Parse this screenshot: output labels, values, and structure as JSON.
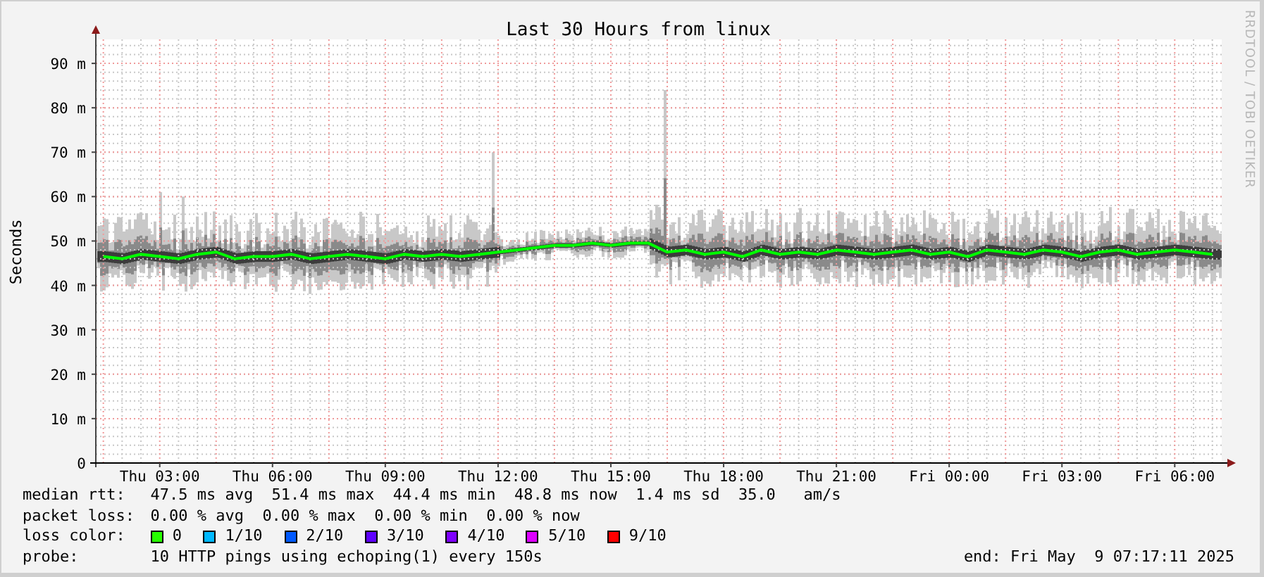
{
  "title": "Last 30 Hours from linux",
  "credit": "RRDTOOL / TOBI OETIKER",
  "chart_data": {
    "type": "line",
    "grid": true,
    "ylabel": "Seconds",
    "ylim": [
      0,
      95.4
    ],
    "categories": [
      null,
      null,
      null,
      "Thu 03:00",
      null,
      null,
      null,
      null,
      null,
      "Thu 06:00",
      null,
      null,
      null,
      null,
      null,
      "Thu 09:00",
      null,
      null,
      null,
      null,
      null,
      "Thu 12:00",
      null,
      null,
      null,
      null,
      null,
      "Thu 15:00",
      null,
      null,
      null,
      null,
      null,
      "Thu 18:00",
      null,
      null,
      null,
      null,
      null,
      "Thu 21:00",
      null,
      null,
      null,
      null,
      null,
      "Fri 00:00",
      null,
      null,
      null,
      null,
      null,
      "Fri 03:00",
      null,
      null,
      null,
      null,
      null,
      "Fri 06:00",
      null,
      null
    ],
    "yticks": [
      {
        "value": 0,
        "label": "0"
      },
      {
        "value": 10,
        "label": "10 m"
      },
      {
        "value": 20,
        "label": "20 m"
      },
      {
        "value": 30,
        "label": "30 m"
      },
      {
        "value": 40,
        "label": "40 m"
      },
      {
        "value": 50,
        "label": "50 m"
      },
      {
        "value": 60,
        "label": "60 m"
      },
      {
        "value": 70,
        "label": "70 m"
      },
      {
        "value": 80,
        "label": "80 m"
      },
      {
        "value": 90,
        "label": "90 m"
      }
    ],
    "series": [
      {
        "name": "median rtt:",
        "color": "#00ff00",
        "values": [
          46.5,
          46,
          47,
          46.5,
          46,
          47,
          47.5,
          46,
          46.5,
          46.5,
          47,
          46,
          46.5,
          47,
          46.5,
          46,
          47,
          46.5,
          47,
          46.5,
          47,
          47.5,
          48,
          48.5,
          49,
          49,
          49.5,
          49,
          49.5,
          49.5,
          47.5,
          48,
          47,
          47.5,
          46.5,
          48,
          47,
          47.5,
          47,
          48,
          47.5,
          47,
          47.5,
          48,
          47,
          47.5,
          46.5,
          48,
          47.5,
          47,
          48,
          47.5,
          46.5,
          47.5,
          48,
          47,
          47.5,
          48,
          47.5,
          47
        ]
      }
    ]
  },
  "legend": {
    "median_rtt": {
      "value": "47.5 ms avg  51.4 ms max  44.4 ms min  48.8 ms now  1.4 ms sd  35.0   am/s"
    },
    "packet_loss": {
      "label": "packet loss:",
      "value": "0.00 % avg  0.00 % max  0.00 % min  0.00 % now"
    },
    "loss_color": {
      "label": "loss color:",
      "items": [
        {
          "label": "0",
          "color": "#26ff00"
        },
        {
          "label": "1/10",
          "color": "#00b8ff"
        },
        {
          "label": "2/10",
          "color": "#0059ff"
        },
        {
          "label": "3/10",
          "color": "#5e00ff"
        },
        {
          "label": "4/10",
          "color": "#7e00ff"
        },
        {
          "label": "5/10",
          "color": "#dd00ff"
        },
        {
          "label": "9/10",
          "color": "#ff0000"
        }
      ]
    },
    "probe": {
      "label": "probe:",
      "value": "10 HTTP pings using echoping(1) every 150s"
    },
    "end": "end: Fri May  9 07:17:11 2025"
  }
}
